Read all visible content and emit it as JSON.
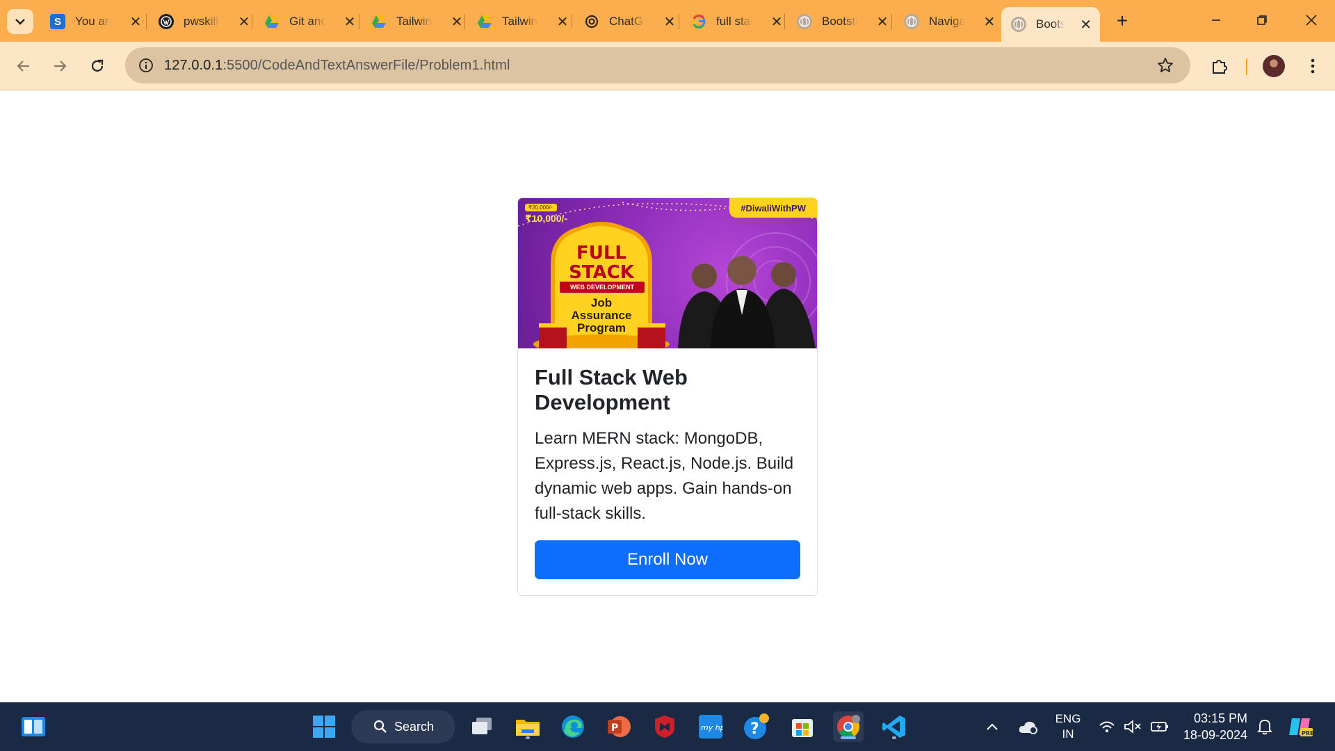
{
  "browser": {
    "tabs": [
      {
        "title": "You are",
        "icon": "s-app-icon",
        "color": "#1f6fd1"
      },
      {
        "title": "pwskills",
        "icon": "wordpress-icon",
        "color": "#1e1e1e"
      },
      {
        "title": "Git and",
        "icon": "google-drive-icon",
        "color": "#34a853"
      },
      {
        "title": "Tailwind",
        "icon": "google-drive-icon",
        "color": "#34a853"
      },
      {
        "title": "Tailwind",
        "icon": "google-drive-icon",
        "color": "#34a853"
      },
      {
        "title": "ChatGPT",
        "icon": "chatgpt-icon",
        "color": "#1e1e1e"
      },
      {
        "title": "full stack",
        "icon": "google-icon",
        "color": "#4285f4"
      },
      {
        "title": "Bootstrap",
        "icon": "globe-icon",
        "color": "#9e8f80"
      },
      {
        "title": "Navigation",
        "icon": "globe-icon",
        "color": "#9e8f80"
      },
      {
        "title": "Bootstrap",
        "icon": "globe-icon",
        "color": "#9e8f80",
        "active": true
      }
    ],
    "url_host": "127.0.0.1",
    "url_path": ":5500/CodeAndTextAnswerFile/Problem1.html"
  },
  "card": {
    "banner": {
      "hashtag": "#DiwaliWithPW",
      "old_price": "₹20,000/-",
      "new_price": "₹10,000/-",
      "line1": "FULL",
      "line2": "STACK",
      "subtitle": "WEB DEVELOPMENT",
      "line3": "Job",
      "line4": "Assurance",
      "line5": "Program"
    },
    "title": "Full Stack Web Development",
    "text": "Learn MERN stack: MongoDB, Express.js, React.js, Node.js. Build dynamic web apps. Gain hands-on full-stack skills.",
    "button": "Enroll Now"
  },
  "taskbar": {
    "search_label": "Search",
    "language": "ENG",
    "region": "IN",
    "time": "03:15 PM",
    "date": "18-09-2024"
  },
  "colors": {
    "tabstrip": "#fcae4f",
    "toolbar": "#fde6c6",
    "button": "#0d6efd",
    "taskbar": "#1b2a44"
  }
}
